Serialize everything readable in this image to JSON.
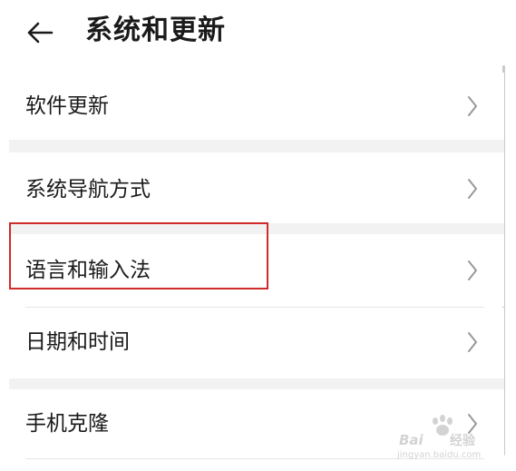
{
  "header": {
    "title": "系统和更新",
    "back_icon": "back-arrow-icon"
  },
  "items": [
    {
      "label": "软件更新",
      "icon": "chevron-right-icon"
    },
    {
      "label": "系统导航方式",
      "icon": "chevron-right-icon"
    },
    {
      "label": "语言和输入法",
      "icon": "chevron-right-icon",
      "highlighted": true
    },
    {
      "label": "日期和时间",
      "icon": "chevron-right-icon"
    },
    {
      "label": "手机克隆",
      "icon": "chevron-right-icon"
    }
  ],
  "watermark": {
    "brand": "Bai du 经验",
    "url": "jingyan.baidu.com"
  },
  "colors": {
    "highlight": "#cf2b2b",
    "section_gap": "#f2f2f2",
    "chevron": "#999999"
  }
}
